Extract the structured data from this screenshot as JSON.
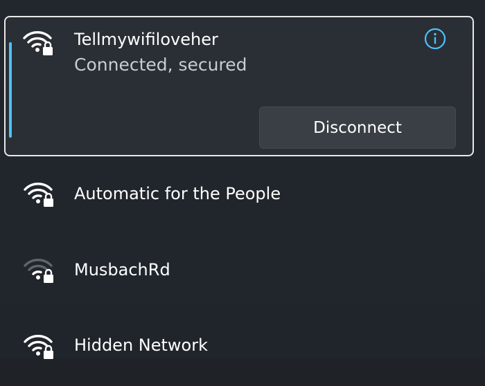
{
  "networks": {
    "connected": {
      "name": "Tellmywifiloveher",
      "status": "Connected, secured",
      "disconnect_label": "Disconnect",
      "info_icon": "info-icon",
      "signal_icon": "wifi-secured-full-icon"
    },
    "available": [
      {
        "name": "Automatic for the People",
        "signal_icon": "wifi-secured-full-icon",
        "signal": "full"
      },
      {
        "name": "MusbachRd",
        "signal_icon": "wifi-secured-weak-icon",
        "signal": "weak"
      },
      {
        "name": "Hidden Network",
        "signal_icon": "wifi-secured-full-icon",
        "signal": "full"
      }
    ]
  },
  "colors": {
    "accent": "#4cc2ff",
    "background": "#1f2328",
    "card": "#2a2f35",
    "button": "#3a3f45",
    "secondary_text": "#c9ccd0"
  }
}
